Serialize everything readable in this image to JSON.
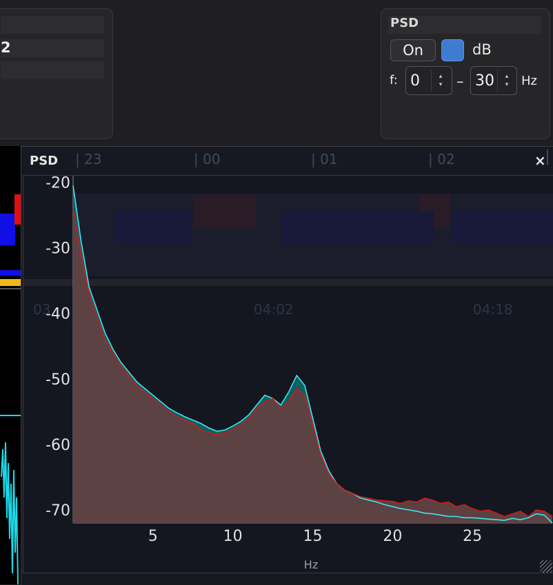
{
  "left_panel": {
    "value_text": "2"
  },
  "psd_settings": {
    "title": "PSD",
    "on_label": "On",
    "db_label": "dB",
    "db_checked": true,
    "f_label": "f:",
    "f_min": "0",
    "dash": "–",
    "f_max": "30",
    "unit": "Hz"
  },
  "psd_window": {
    "title": "PSD",
    "close_label": "×",
    "timeline_ticks": [
      "| 23",
      "| 00",
      "| 01",
      "| 02"
    ],
    "background_time_labels": [
      "03",
      "04:02",
      "04:18"
    ],
    "resize_grip": "//"
  },
  "colors": {
    "accent_blue": "#3f7bd0",
    "series_cyan": "#3fe6f0",
    "series_red": "#e01515",
    "fill": "#5a4748"
  },
  "chart_data": {
    "type": "area",
    "xlabel": "Hz",
    "ylabel": "",
    "xlim": [
      0,
      30
    ],
    "ylim": [
      -72,
      -19
    ],
    "x_ticks": [
      5,
      10,
      15,
      20,
      25
    ],
    "y_ticks": [
      -20,
      -30,
      -40,
      -50,
      -60,
      -70
    ],
    "legend": "none",
    "grid": false,
    "x": [
      0,
      0.5,
      1,
      1.5,
      2,
      2.5,
      3,
      3.5,
      4,
      4.5,
      5,
      5.5,
      6,
      6.5,
      7,
      7.5,
      8,
      8.5,
      9,
      9.5,
      10,
      10.5,
      11,
      11.5,
      12,
      12.5,
      13,
      13.5,
      14,
      14.5,
      15,
      15.5,
      16,
      16.5,
      17,
      17.5,
      18,
      18.5,
      19,
      19.5,
      20,
      20.5,
      21,
      21.5,
      22,
      22.5,
      23,
      23.5,
      24,
      24.5,
      25,
      25.5,
      26,
      26.5,
      27,
      27.5,
      28,
      28.5,
      29,
      29.5,
      30
    ],
    "series": [
      {
        "color": "#3fe6f0",
        "values": [
          -20.5,
          -29,
          -36,
          -39.5,
          -43,
          -45.5,
          -47.5,
          -49,
          -50.5,
          -51.5,
          -52.5,
          -53.5,
          -54.5,
          -55.2,
          -55.8,
          -56.3,
          -56.8,
          -57.5,
          -58,
          -57.8,
          -57.2,
          -56.5,
          -55.5,
          -54,
          -52.5,
          -53,
          -54,
          -52,
          -49.5,
          -51,
          -56,
          -61,
          -64,
          -66,
          -67,
          -67.5,
          -68.2,
          -68.5,
          -68.8,
          -69.2,
          -69.5,
          -69.8,
          -70,
          -70.2,
          -70.5,
          -70.6,
          -70.8,
          -71,
          -71,
          -71.2,
          -71.2,
          -71.3,
          -71.4,
          -71.5,
          -71.6,
          -71.3,
          -71.5,
          -71.2,
          -70.6,
          -70.8,
          -72
        ]
      },
      {
        "color": "#e01515",
        "values": [
          -24,
          -31,
          -37,
          -40.5,
          -44,
          -46,
          -48,
          -49.5,
          -51,
          -52,
          -53,
          -54,
          -55,
          -55.8,
          -56.3,
          -56.8,
          -57.8,
          -58.2,
          -58.6,
          -58.2,
          -57.8,
          -57,
          -56,
          -54.5,
          -53.5,
          -53,
          -54.5,
          -53.5,
          -51.5,
          -52.5,
          -57,
          -61.5,
          -64.5,
          -66,
          -67,
          -67.5,
          -68,
          -68.2,
          -68.5,
          -68.6,
          -68.7,
          -69,
          -68.6,
          -68.8,
          -68.2,
          -68.5,
          -69,
          -68.8,
          -69.5,
          -69.2,
          -69.8,
          -70.2,
          -70,
          -70.5,
          -71,
          -70.6,
          -70.2,
          -71,
          -70,
          -70.2,
          -71
        ]
      }
    ]
  }
}
